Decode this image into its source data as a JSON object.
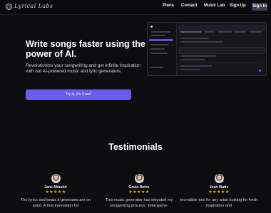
{
  "brand": {
    "name": "Lyrical Labs"
  },
  "nav": {
    "links": [
      "Plans",
      "Contact",
      "Music Lab",
      "Sign Up"
    ],
    "signin": "Sign In"
  },
  "hero": {
    "title": "Write songs faster using the power of AI.",
    "subtitle": "Revolutionize your songwriting and get infinite inspiration with our AI-powered music and lyric generators.",
    "cta": "Try it, it's Free!"
  },
  "testimonials": {
    "heading": "Testimonials",
    "items": [
      {
        "name": "Jane Akbulut",
        "rating": 5,
        "stars": "★★★★★",
        "quote": "The lyrics and beats it generates are on point. A true innovation for"
      },
      {
        "name": "Gavin Beins",
        "rating": 5,
        "stars": "★★★★★",
        "quote": "This music generator has elevated my songwriting process. Total game-"
      },
      {
        "name": "Josh Watts",
        "rating": 5,
        "stars": "★★★★★",
        "quote": "Incredible tool for any artist looking for fresh inspiration and"
      }
    ]
  },
  "colors": {
    "background": "#0d0d10",
    "accent": "#6b5cf0",
    "star": "#f5b80b"
  }
}
